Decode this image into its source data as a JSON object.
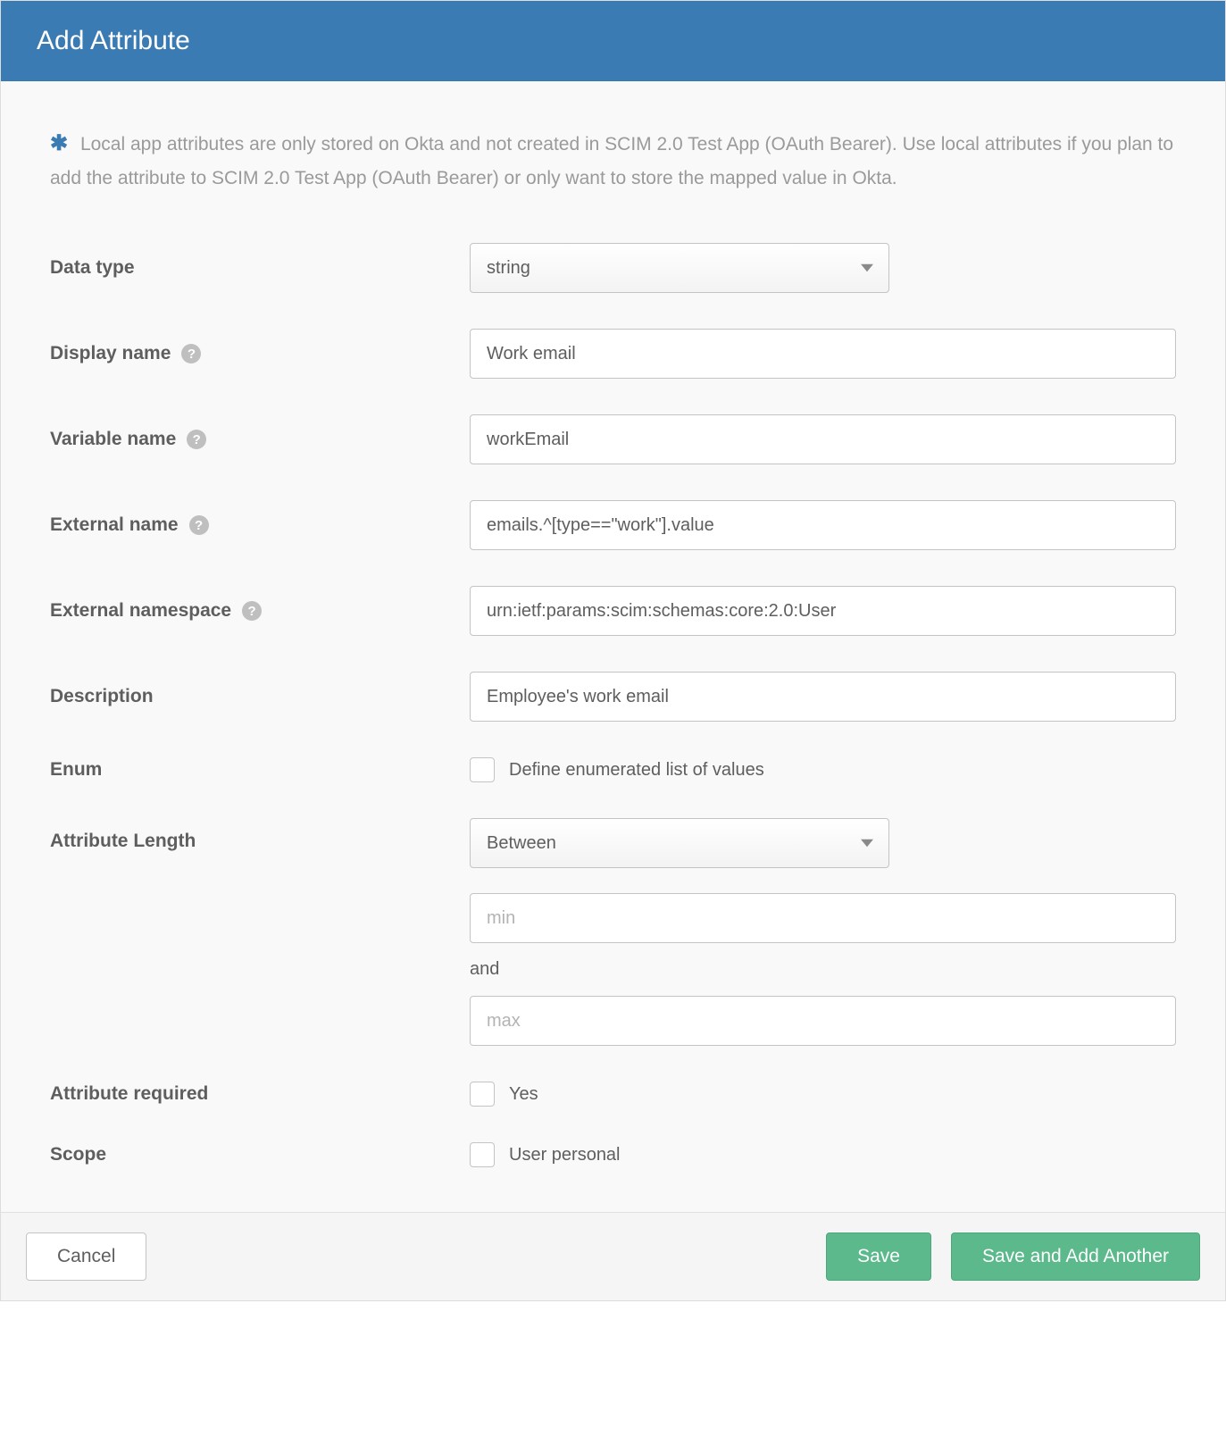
{
  "header": {
    "title": "Add Attribute"
  },
  "info": {
    "asterisk": "✱",
    "text": "Local app attributes are only stored on Okta and not created in SCIM 2.0 Test App (OAuth Bearer). Use local attributes if you plan to add the attribute to SCIM 2.0 Test App (OAuth Bearer) or only want to store the mapped value in Okta."
  },
  "labels": {
    "data_type": "Data type",
    "display_name": "Display name",
    "variable_name": "Variable name",
    "external_name": "External name",
    "external_namespace": "External namespace",
    "description": "Description",
    "enum": "Enum",
    "attribute_length": "Attribute Length",
    "attribute_required": "Attribute required",
    "scope": "Scope"
  },
  "values": {
    "data_type": "string",
    "display_name": "Work email",
    "variable_name": "workEmail",
    "external_name": "emails.^[type==\"work\"].value",
    "external_namespace": "urn:ietf:params:scim:schemas:core:2.0:User",
    "description": "Employee's work email",
    "enum_label": "Define enumerated list of values",
    "attribute_length": "Between",
    "min_placeholder": "min",
    "and": "and",
    "max_placeholder": "max",
    "required_label": "Yes",
    "scope_label": "User personal"
  },
  "help_glyph": "?",
  "footer": {
    "cancel": "Cancel",
    "save": "Save",
    "save_add_another": "Save and Add Another"
  }
}
